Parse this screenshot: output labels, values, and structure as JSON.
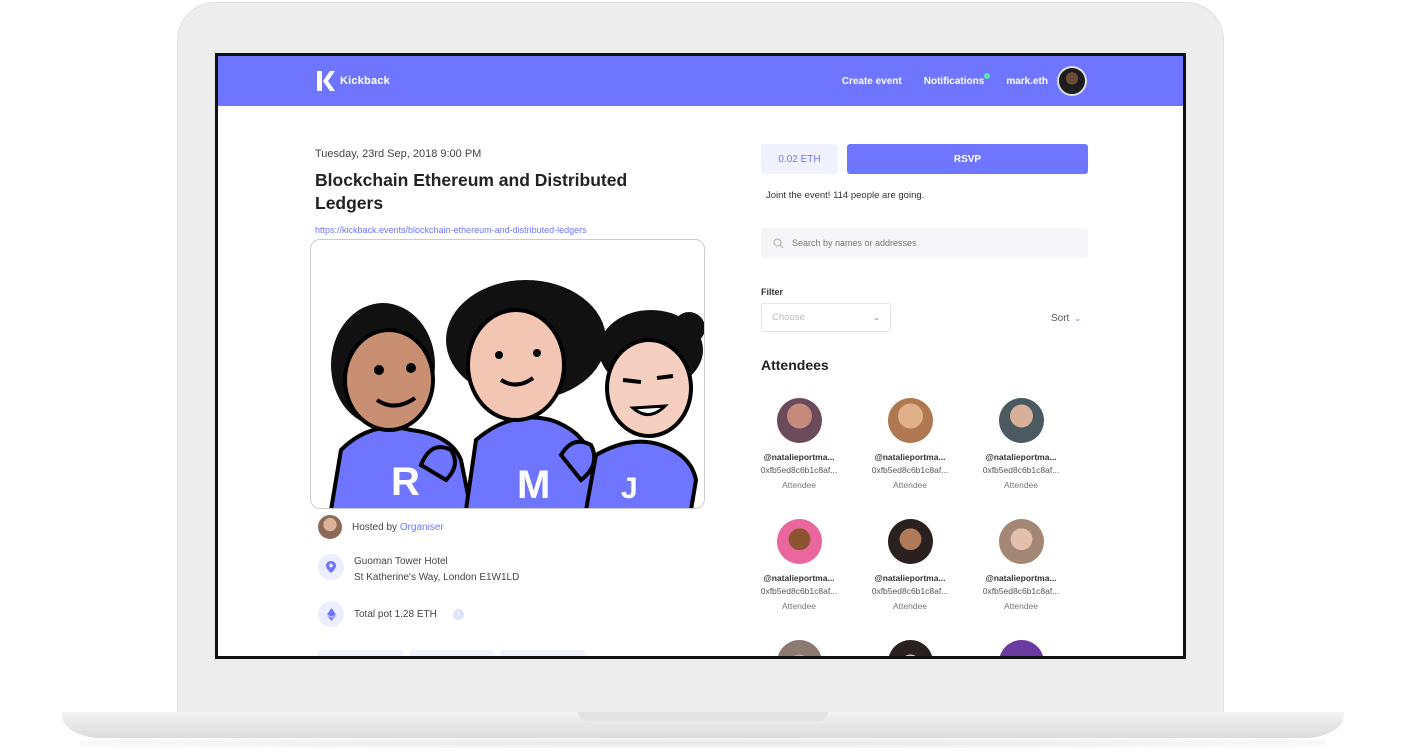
{
  "header": {
    "brand": "Kickback",
    "nav": {
      "create_event": "Create event",
      "notifications": "Notifications",
      "user": "mark.eth"
    }
  },
  "event": {
    "date": "Tuesday, 23rd Sep, 2018 9:00 PM",
    "title": "Blockchain Ethereum and Distributed Ledgers",
    "link": "https://kickback.events/blockchain-ethereum-and-distributed-ledgers",
    "image_letters": [
      "R",
      "M",
      "J"
    ],
    "hosted_by_label": "Hosted by",
    "organiser": "Organiser",
    "venue_name": "Guoman Tower Hotel",
    "venue_address": "St Katherine's Way, London E1W1LD",
    "pot": "Total pot 1.28 ETH"
  },
  "rsvp": {
    "price": "0.02 ETH",
    "button": "RSVP",
    "going_text": "Joint the event! 114 people are going."
  },
  "search": {
    "placeholder": "Search by names or addresses"
  },
  "filter": {
    "label": "Filter",
    "placeholder": "Choose",
    "sort_label": "Sort"
  },
  "attendees": {
    "title": "Attendees",
    "items": [
      {
        "name": "@natalieportma...",
        "address": "0xfb5ed8c6b1c8af...",
        "role": "Attendee",
        "color": "#6b4a5a"
      },
      {
        "name": "@natalieportma...",
        "address": "0xfb5ed8c6b1c8af...",
        "role": "Attendee",
        "color": "#b07850"
      },
      {
        "name": "@natalieportma...",
        "address": "0xfb5ed8c6b1c8af...",
        "role": "Attendee",
        "color": "#4a5a60"
      },
      {
        "name": "@natalieportma...",
        "address": "0xfb5ed8c6b1c8af...",
        "role": "Attendee",
        "color": "#e9679c"
      },
      {
        "name": "@natalieportma...",
        "address": "0xfb5ed8c6b1c8af...",
        "role": "Attendee",
        "color": "#5a4030"
      },
      {
        "name": "@natalieportma...",
        "address": "0xfb5ed8c6b1c8af...",
        "role": "Attendee",
        "color": "#a48876"
      }
    ],
    "partial_colors": [
      "#8a7a70",
      "#3a3030",
      "#3a6ad0"
    ]
  },
  "colors": {
    "accent": "#6e76ff",
    "notification_dot": "#5fe1b5"
  }
}
